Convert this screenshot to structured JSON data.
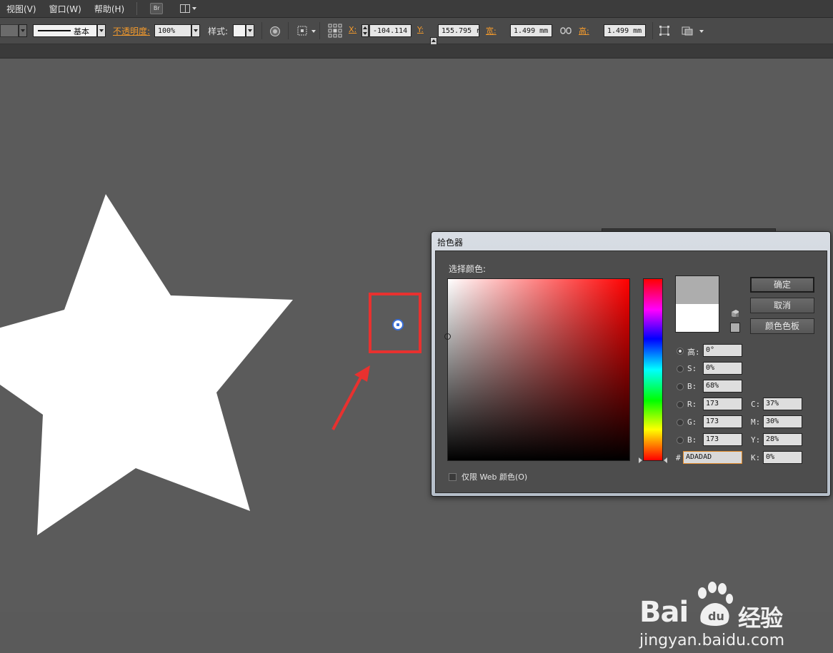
{
  "menubar": {
    "items": [
      "视图(V)",
      "窗口(W)",
      "帮助(H)"
    ],
    "bridge_label": "Br"
  },
  "controlbar": {
    "stroke_profile": "基本",
    "opacity_label": "不透明度:",
    "opacity_value": "100%",
    "style_label": "样式:",
    "x_label": "X:",
    "x_value": "-104.114",
    "y_label": "Y:",
    "y_value": "155.795 r",
    "width_label": "宽:",
    "width_value": "1.499 mm",
    "height_label": "高:",
    "height_value": "1.499 mm"
  },
  "dialog": {
    "title": "拾色器",
    "select_color_label": "选择颜色:",
    "ok_button": "确定",
    "cancel_button": "取消",
    "swatches_button": "颜色色板",
    "new_color": "#adadad",
    "old_color": "#ffffff",
    "hsb": [
      {
        "label": "高:",
        "value": "0°",
        "selected": true
      },
      {
        "label": "S:",
        "value": "0%",
        "selected": false
      },
      {
        "label": "B:",
        "value": "68%",
        "selected": false
      }
    ],
    "rgb": [
      {
        "label": "R:",
        "value": "173"
      },
      {
        "label": "G:",
        "value": "173"
      },
      {
        "label": "B:",
        "value": "173"
      }
    ],
    "cmyk": [
      {
        "label": "C:",
        "value": "37%"
      },
      {
        "label": "M:",
        "value": "30%"
      },
      {
        "label": "Y:",
        "value": "28%"
      },
      {
        "label": "K:",
        "value": "0%"
      }
    ],
    "hex_prefix": "#",
    "hex_value": "ADADAD",
    "web_only_label": "仅限 Web 颜色(O)"
  },
  "canvas": {
    "star_color": "#ffffff",
    "highlight_color": "#e8312f"
  },
  "watermark": {
    "brand_text": "Bai",
    "brand_cjk": "经验",
    "url": "jingyan.baidu.com"
  }
}
